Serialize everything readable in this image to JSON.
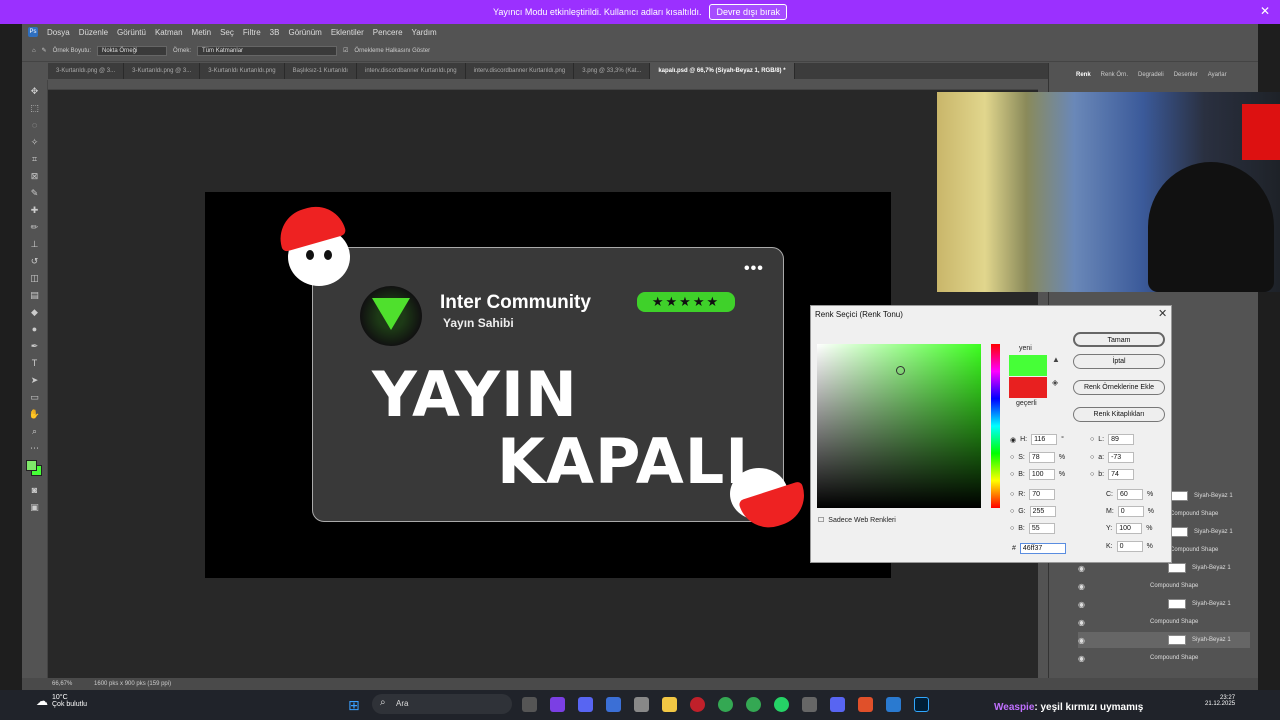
{
  "notice": {
    "text": "Yayıncı Modu etkinleştirildi. Kullanıcı adları kısaltıldı.",
    "button": "Devre dışı bırak"
  },
  "menu": [
    "Dosya",
    "Düzenle",
    "Görüntü",
    "Katman",
    "Metin",
    "Seç",
    "Filtre",
    "3B",
    "Görünüm",
    "Eklentiler",
    "Pencere",
    "Yardım"
  ],
  "options": {
    "sample_size_label": "Örnek Boyutu:",
    "sample_size": "Nokta Örneği",
    "sample_label": "Örnek:",
    "sample": "Tüm Katmanlar",
    "ring_label": "Örnekleme Halkasını Göster"
  },
  "tabs": [
    "3-Kurtarıldı.png @ 3...",
    "3-Kurtarıldı.png @ 3...",
    "3-Kurtarıldı Kurtarıldı.png",
    "Başlıksız-1 Kurtarıldı",
    "interv.discordbanner Kurtarıldı.png",
    "interv.discordbanner Kurtarıldı.png",
    "3.png @ 33,3% (Kat...",
    "kapalı.psd @ 66,7% (Siyah-Beyaz 1, RGB/8) *"
  ],
  "artwork": {
    "community": "Inter Community",
    "role": "Yayın Sahibi",
    "stars": "★★★★★",
    "line1": "YAYIN",
    "line2": "KAPALI",
    "dots": "•••"
  },
  "right_panel": {
    "tabs": [
      "Renk",
      "Renk Örn.",
      "Degradeli",
      "Desenler",
      "Ayarlar"
    ]
  },
  "layers": [
    {
      "name": "Siyah-Beyaz 1"
    },
    {
      "name": "Compound Shape"
    },
    {
      "name": "Siyah-Beyaz 1"
    },
    {
      "name": "Compound Shape"
    },
    {
      "name": "Siyah-Beyaz 1"
    },
    {
      "name": "Compound Shape"
    },
    {
      "name": "Siyah-Beyaz 1"
    },
    {
      "name": "Compound Shape"
    },
    {
      "name": "Siyah-Beyaz 1"
    },
    {
      "name": "Compound Shape"
    }
  ],
  "color_picker": {
    "title": "Renk Seçici (Renk Tonu)",
    "new_label": "yeni",
    "current_label": "geçerli",
    "ok": "Tamam",
    "cancel": "İptal",
    "add_swatch": "Renk Örneklerine Ekle",
    "libraries": "Renk Kitaplıkları",
    "web_only": "Sadece Web Renkleri",
    "new_color": "#46ff37",
    "current_color": "#e82020",
    "H": "116",
    "S": "78",
    "B": "100",
    "R": "70",
    "G": "255",
    "Bv": "55",
    "L": "89",
    "a": "-73",
    "b": "74",
    "C": "60",
    "M": "0",
    "Y": "100",
    "K": "0",
    "hex": "46ff37",
    "deg": "°",
    "pct": "%"
  },
  "status": {
    "zoom": "66,67%",
    "size": "1600 pks x 900 pks (159 ppi)"
  },
  "taskbar": {
    "temp": "10°C",
    "weather": "Çok bulutlu",
    "search": "Ara",
    "time": "23:27",
    "date": "21.12.2025"
  },
  "chat": {
    "user": "Weaspie",
    "message": ": yeşil kırmızı uymamış"
  }
}
